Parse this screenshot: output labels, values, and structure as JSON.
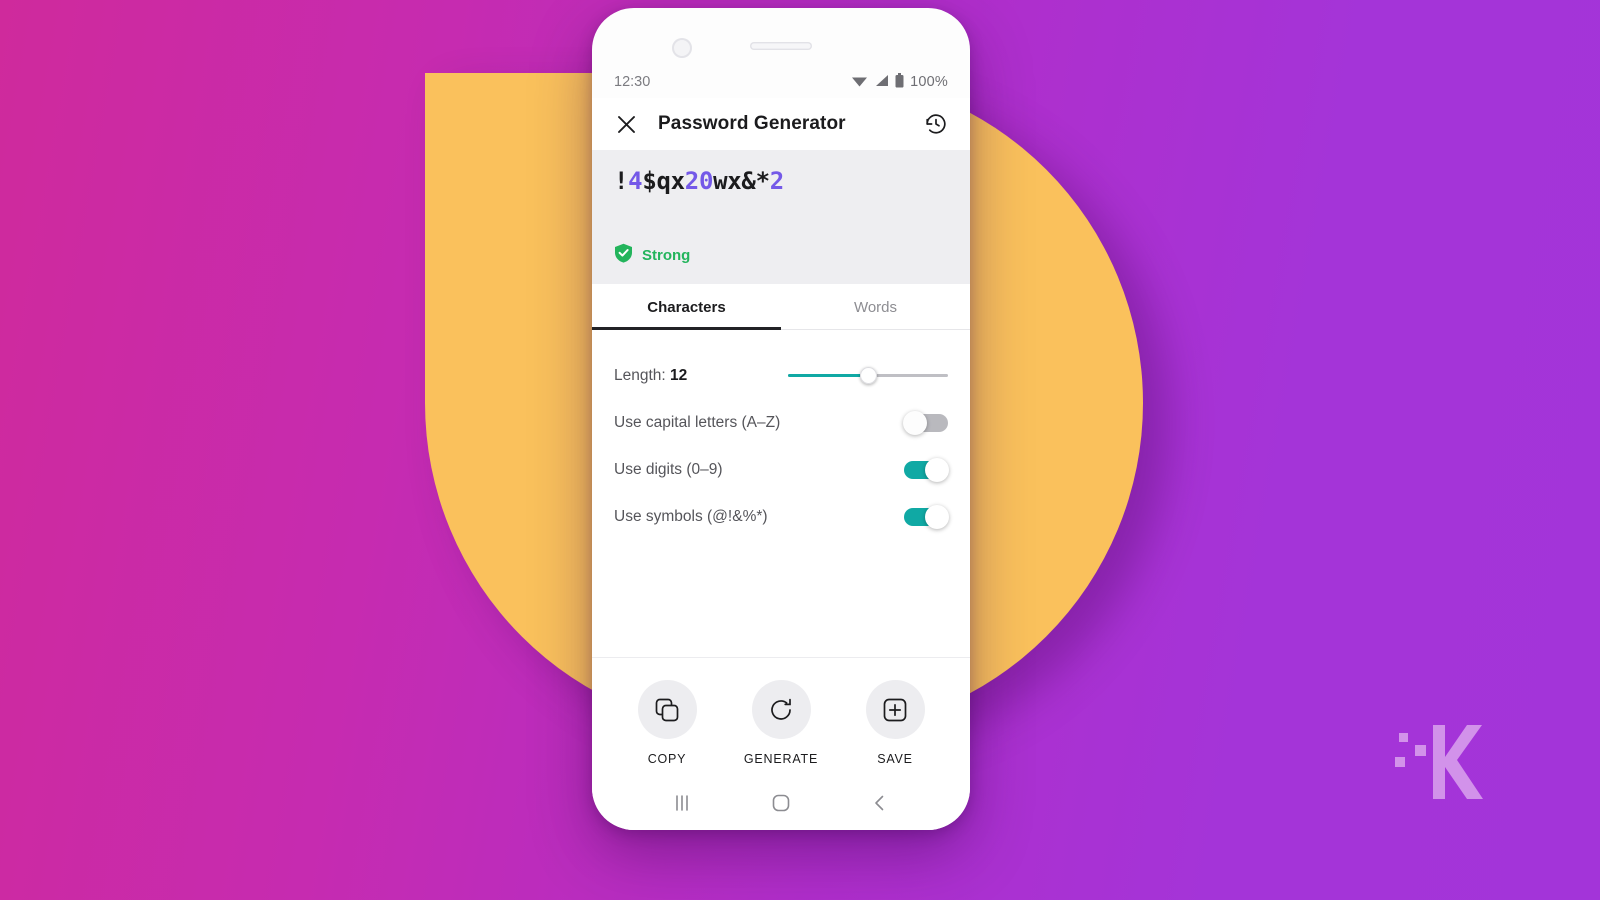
{
  "background": {
    "gradient_from": "#cf2a9c",
    "gradient_to": "#a334d9",
    "accent_shape_color": "#fac15c"
  },
  "watermark": {
    "name": "k-logo"
  },
  "phone": {
    "status_bar": {
      "time": "12:30",
      "battery_percent": "100%",
      "icons": [
        "wifi-icon",
        "signal-icon",
        "battery-icon"
      ]
    },
    "app_bar": {
      "close_label": "×",
      "title": "Password Generator",
      "history_icon": "history-icon"
    },
    "password_panel": {
      "password": "!4$qx20wx&*2",
      "password_chars": [
        {
          "c": "!",
          "type": "symbol"
        },
        {
          "c": "4",
          "type": "digit"
        },
        {
          "c": "$",
          "type": "symbol"
        },
        {
          "c": "q",
          "type": "letter"
        },
        {
          "c": "x",
          "type": "letter"
        },
        {
          "c": "2",
          "type": "digit"
        },
        {
          "c": "0",
          "type": "digit"
        },
        {
          "c": "w",
          "type": "letter"
        },
        {
          "c": "x",
          "type": "letter"
        },
        {
          "c": "&",
          "type": "symbol"
        },
        {
          "c": "*",
          "type": "symbol"
        },
        {
          "c": "2",
          "type": "digit"
        }
      ],
      "digit_color": "#7459e8",
      "strength_label": "Strong",
      "strength_color": "#23b45c",
      "strength_icon": "shield-check-icon"
    },
    "tabs": [
      {
        "label": "Characters",
        "active": true
      },
      {
        "label": "Words",
        "active": false
      }
    ],
    "settings": {
      "length_label": "Length:",
      "length_value": "12",
      "length_slider_percent": 50,
      "slider_color": "#10a9a4",
      "options": [
        {
          "label": "Use capital letters (A–Z)",
          "enabled": false
        },
        {
          "label": "Use digits (0–9)",
          "enabled": true
        },
        {
          "label": "Use symbols (@!&%*)",
          "enabled": true
        }
      ]
    },
    "actions": [
      {
        "label": "COPY",
        "icon": "copy-icon"
      },
      {
        "label": "GENERATE",
        "icon": "refresh-icon"
      },
      {
        "label": "SAVE",
        "icon": "plus-square-icon"
      }
    ],
    "nav_bar": [
      {
        "name": "recents-button",
        "icon": "recents-icon"
      },
      {
        "name": "home-button",
        "icon": "home-icon"
      },
      {
        "name": "back-button",
        "icon": "back-icon"
      }
    ]
  }
}
